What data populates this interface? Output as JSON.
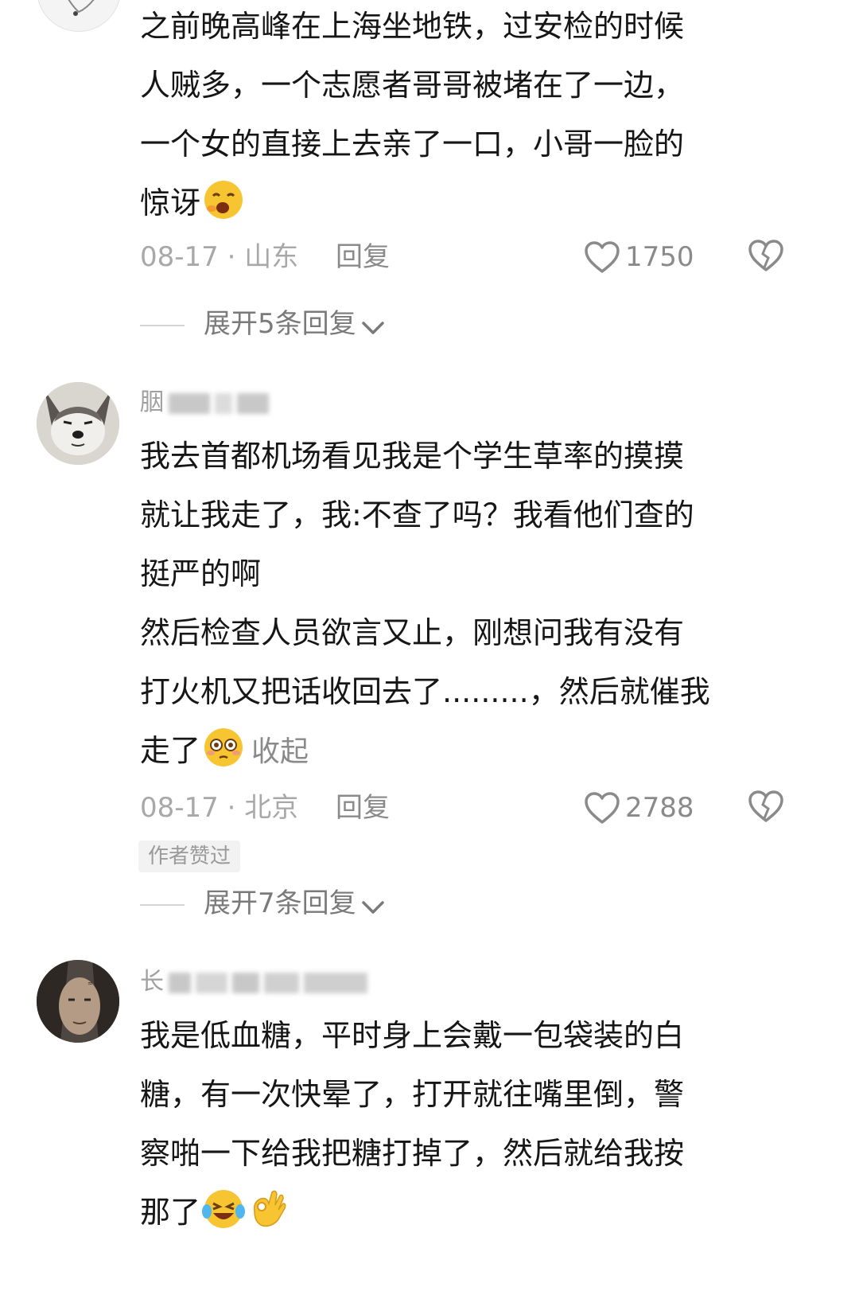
{
  "comments": [
    {
      "lines": [
        "之前晚高峰在上海坐地铁，过安检的时候",
        "人贼多，一个志愿者哥哥被堵在了一边，",
        "一个女的直接上去亲了一口，小哥一脸的"
      ],
      "last_line": "惊讶",
      "emoji": [
        "yawning-face-icon"
      ],
      "date": "08-17 · 山东",
      "reply_label": "回复",
      "likes": "1750",
      "expand_label": "展开5条回复"
    },
    {
      "username_visible": "胭",
      "lines": [
        "我去首都机场看见我是个学生草率的摸摸",
        "就让我走了，我:不查了吗？我看他们查的",
        "挺严的啊",
        "然后检查人员欲言又止，刚想问我有没有",
        "打火机又把话收回去了.........，然后就催我"
      ],
      "last_line": "走了",
      "emoji": [
        "flushed-face-icon"
      ],
      "collapse_label": "收起",
      "date": "08-17 · 北京",
      "reply_label": "回复",
      "likes": "2788",
      "badge": "作者赞过",
      "expand_label": "展开7条回复"
    },
    {
      "username_visible": "长",
      "lines": [
        "我是低血糖，平时身上会戴一包袋装的白",
        "糖，有一次快晕了，打开就往嘴里倒，警",
        "察啪一下给我把糖打掉了，然后就给我按"
      ],
      "last_line": "那了",
      "emoji": [
        "laughing-tears-icon",
        "ok-hand-icon"
      ]
    }
  ],
  "colors": {
    "text": "#161616",
    "meta": "#a8a8a8",
    "emoji_yellow": "#f7c531"
  }
}
